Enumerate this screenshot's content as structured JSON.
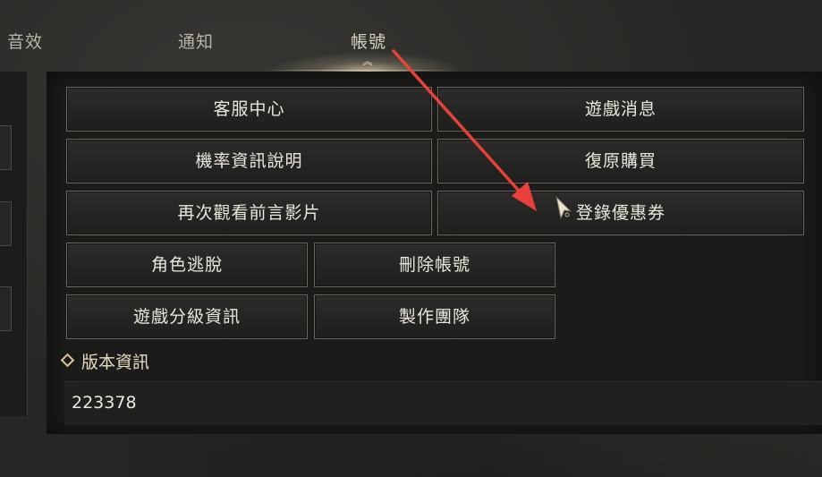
{
  "tabs": [
    {
      "label": "音效",
      "active": false
    },
    {
      "label": "通知",
      "active": false
    },
    {
      "label": "帳號",
      "active": true
    }
  ],
  "buttons": {
    "customer_service": "客服中心",
    "game_news": "遊戲消息",
    "probability_info": "機率資訊說明",
    "restore_purchase": "復原購買",
    "rewatch_prologue": "再次觀看前言影片",
    "redeem_coupon": "登錄優惠券",
    "character_escape": "角色逃脫",
    "delete_account": "刪除帳號",
    "game_rating_info": "遊戲分級資訊",
    "credits": "製作團隊"
  },
  "version": {
    "title": "版本資訊",
    "value": "223378"
  },
  "colors": {
    "annotation_arrow": "#e8413a",
    "active_tab_glow": "#e6d7b4",
    "button_border": "#6a665d"
  }
}
